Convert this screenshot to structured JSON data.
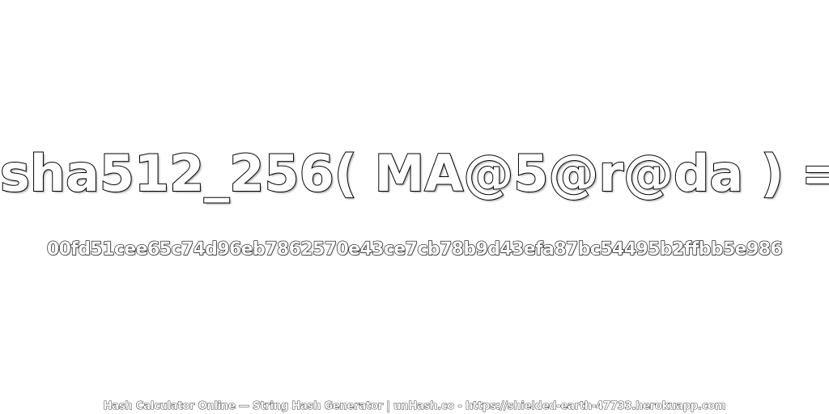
{
  "expression": "sha512_256( MA@5@r@da ) =",
  "hash_value": "00fd51cee65c74d96eb7862570e43ce7cb78b9d43efa87bc54495b2ffbb5e986",
  "footer": "Hash Calculator Online — String Hash Generator | unHash.co - https://shielded-earth-47733.herokuapp.com",
  "colors": {
    "background": "#ffffff",
    "text_fill": "#ffffff",
    "text_stroke": "#000000"
  }
}
